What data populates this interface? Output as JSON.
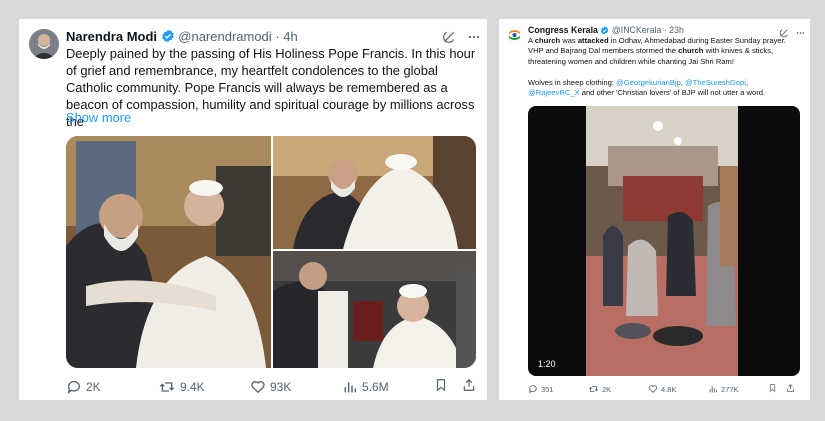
{
  "tweet1": {
    "name": "Narendra Modi",
    "handle": "@narendramodi",
    "time": "· 4h",
    "body": "Deeply pained by the passing of His Holiness Pope Francis. In this hour of grief and remembrance, my heartfelt condolences to the global Catholic community. Pope Francis will always be remembered as a beacon of compassion, humility and spiritual courage by millions across the",
    "show_more": "Show more",
    "replies": "2K",
    "reposts": "9.4K",
    "likes": "93K",
    "views": "5.6M"
  },
  "tweet2": {
    "name": "Congress Kerala",
    "handle": "@INCKerala",
    "time": "· 23h",
    "line1_a": "A ",
    "line1_b": "church",
    "line1_c": " was ",
    "line1_d": "attacked",
    "line1_e": " in Odhav, Ahmedabad during Easter Sunday prayer.",
    "line2_a": "VHP and Bajrang Dal members stormed the ",
    "line2_b": "church",
    "line2_c": " with knives & sticks,",
    "line3": "threatening women and children while chanting Jai Shri Ram!",
    "line4_a": "Wolves in sheep clothing: ",
    "mention1": "@GeorgekurianBjp",
    "sep1": ", ",
    "mention2": "@TheSureshGopi",
    "sep2": ",",
    "mention3": "@RajeevRC_X",
    "line5_b": " and other 'Christian lovers' of BJP will not utter a word.",
    "video_duration": "1:20",
    "replies": "351",
    "reposts": "2K",
    "likes": "4.8K",
    "views": "277K"
  },
  "colors": {
    "link": "#1d9bf0",
    "verified": "#1d9bf0",
    "muted": "#536471"
  }
}
